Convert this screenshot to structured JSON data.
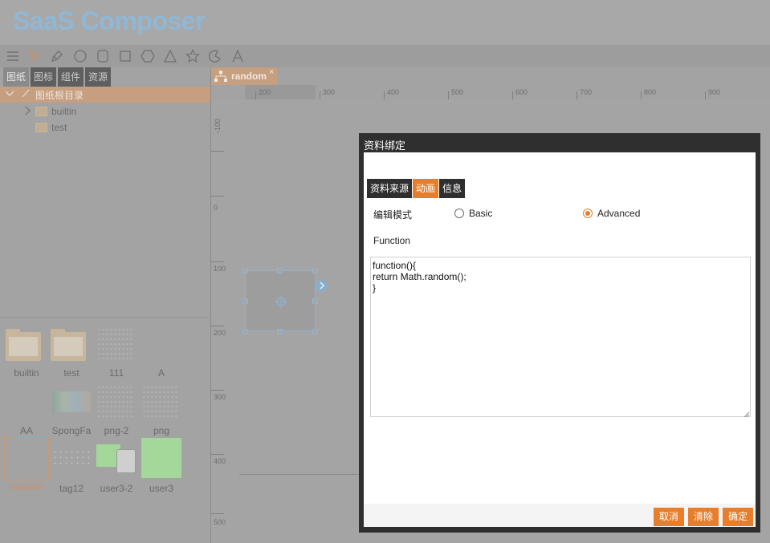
{
  "app": {
    "title": "SaaS Composer"
  },
  "toolbar": {
    "tools": [
      "menu-icon",
      "pointer-icon",
      "pen-icon",
      "circle-icon",
      "rounded-rect-icon",
      "rect-icon",
      "hexagon-icon",
      "triangle-icon",
      "star-icon",
      "arc-icon",
      "text-icon"
    ]
  },
  "left_panel": {
    "tabs": [
      {
        "label": "图纸"
      },
      {
        "label": "图标"
      },
      {
        "label": "组件"
      },
      {
        "label": "资源"
      }
    ],
    "tree": {
      "root_label": "图纸根目录",
      "items": [
        {
          "label": "builtin"
        },
        {
          "label": "test"
        }
      ]
    },
    "grid": [
      {
        "label": "builtin"
      },
      {
        "label": "test"
      },
      {
        "label": "111"
      },
      {
        "label": "A"
      },
      {
        "label": "AA"
      },
      {
        "label": "SpongFa"
      },
      {
        "label": "png-2"
      },
      {
        "label": "png"
      },
      {
        "label": "random"
      },
      {
        "label": "tag12"
      },
      {
        "label": "user3-2"
      },
      {
        "label": "user3"
      }
    ]
  },
  "editor": {
    "tab_label": "random",
    "tab_close": "×",
    "hruler": [
      "200",
      "300",
      "400",
      "500",
      "600",
      "700",
      "800",
      "900"
    ],
    "vruler": [
      "-100",
      "0",
      "100",
      "200",
      "300",
      "400",
      "500"
    ]
  },
  "dialog": {
    "title": "资料绑定",
    "tabs": [
      {
        "label": "资料来源"
      },
      {
        "label": "动画"
      },
      {
        "label": "信息"
      }
    ],
    "mode_label": "编辑模式",
    "mode_options": [
      {
        "label": "Basic",
        "checked": false
      },
      {
        "label": "Advanced",
        "checked": true
      }
    ],
    "function_label": "Function",
    "function_code": "function(){\nreturn Math.random();\n}",
    "buttons": {
      "cancel": "取消",
      "clear": "清除",
      "ok": "确定"
    },
    "accent_color": "#e87d2a"
  }
}
